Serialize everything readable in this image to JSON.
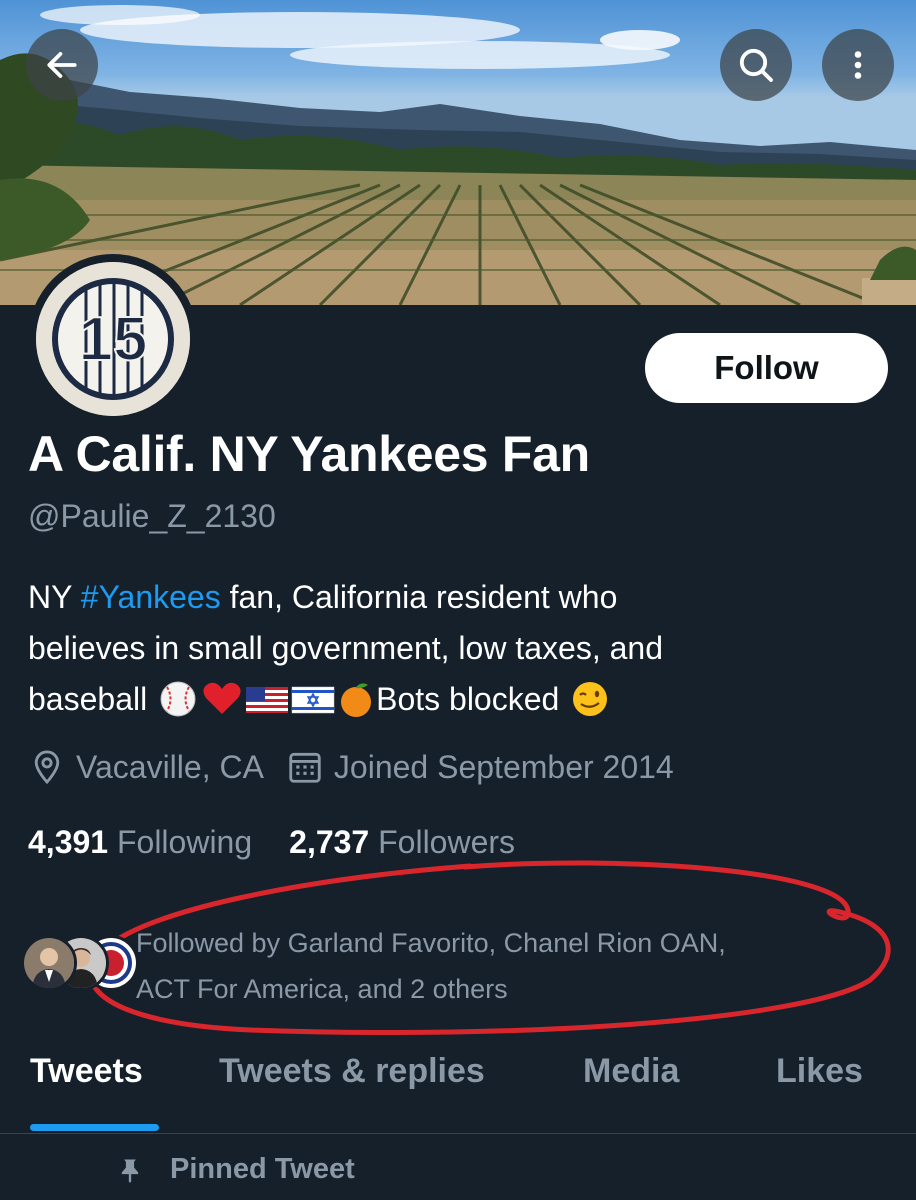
{
  "header": {
    "back_icon": "arrow-left-icon",
    "search_icon": "search-icon",
    "more_icon": "more-vertical-icon"
  },
  "profile": {
    "avatar_number": "15",
    "follow_label": "Follow",
    "display_name": "A Calif. NY Yankees Fan",
    "handle": "@Paulie_Z_2130",
    "bio": {
      "line1_prefix": "NY ",
      "hashtag": "#Yankees",
      "line1_suffix": " fan, California resident who",
      "line2": "believes in small government, low taxes, and",
      "line3_prefix": "baseball ",
      "line3_text": "Bots blocked ",
      "emojis": [
        "baseball",
        "red-heart",
        "us-flag",
        "israel-flag",
        "tangerine",
        "winking-face"
      ]
    },
    "location": "Vacaville, CA",
    "joined": "Joined September 2014",
    "following_count": "4,391",
    "following_label": "Following",
    "followers_count": "2,737",
    "followers_label": "Followers",
    "followed_by_line1": "Followed by Garland Favorito, Chanel Rion OAN,",
    "followed_by_line2": "ACT For America, and 2 others"
  },
  "tabs": [
    {
      "label": "Tweets",
      "active": true
    },
    {
      "label": "Tweets & replies",
      "active": false
    },
    {
      "label": "Media",
      "active": false
    },
    {
      "label": "Likes",
      "active": false
    }
  ],
  "pinned_label": "Pinned Tweet",
  "colors": {
    "background": "#15202b",
    "accent": "#1d9bf0",
    "secondary_text": "#8b98a5",
    "annotation": "#d9262c"
  }
}
